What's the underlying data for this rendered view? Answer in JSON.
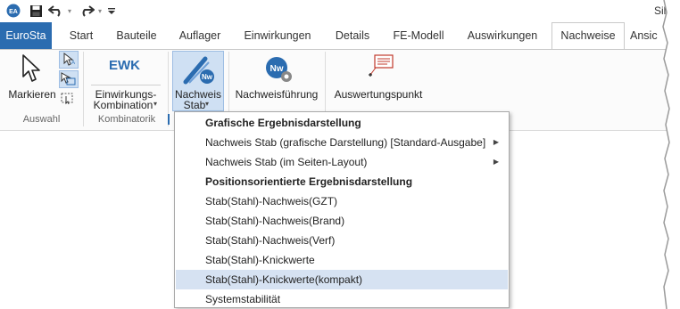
{
  "window": {
    "title_fragment": "Silo"
  },
  "quick_access": {
    "app_icon": "eurosta-logo-icon",
    "save_icon": "save-icon",
    "undo_icon": "undo-icon",
    "redo_icon": "redo-icon",
    "customize_icon": "customize-toolbar-icon"
  },
  "tabs": [
    {
      "label": "EuroSta",
      "state": "file"
    },
    {
      "label": "Start"
    },
    {
      "label": "Bauteile"
    },
    {
      "label": "Auflager"
    },
    {
      "label": "Einwirkungen"
    },
    {
      "label": "Details"
    },
    {
      "label": "FE-Modell"
    },
    {
      "label": "Auswirkungen"
    },
    {
      "label": "Nachweise",
      "state": "active"
    },
    {
      "label": "Ansic"
    }
  ],
  "ribbon": {
    "groups": [
      {
        "label": "Auswahl"
      },
      {
        "label": "Kombinatorik"
      }
    ],
    "buttons": {
      "markieren": "Markieren",
      "ewk_icon_text": "EWK",
      "einwirkungs_line1": "Einwirkungs-",
      "einwirkungs_line2": "Kombination",
      "nachweis_line1": "Nachweis",
      "nachweis_line2": "Stab",
      "nw_icon_text": "Nw",
      "nachweisfuehrung": "Nachweisführung",
      "auswertungspunkt": "Auswertungspunkt"
    }
  },
  "menu": {
    "items": [
      {
        "label": "Grafische Ergebnisdarstellung",
        "type": "header"
      },
      {
        "label": "Nachweis Stab (grafische Darstellung) [Standard-Ausgabe]",
        "submenu": true
      },
      {
        "label": "Nachweis Stab (im Seiten-Layout)",
        "submenu": true
      },
      {
        "label": "Positionsorientierte Ergebnisdarstellung",
        "type": "header"
      },
      {
        "label": "Stab(Stahl)-Nachweis(GZT)"
      },
      {
        "label": "Stab(Stahl)-Nachweis(Brand)"
      },
      {
        "label": "Stab(Stahl)-Nachweis(Verf)"
      },
      {
        "label": "Stab(Stahl)-Knickwerte"
      },
      {
        "label": "Stab(Stahl)-Knickwerte(kompakt)",
        "highlighted": true
      },
      {
        "label": "Systemstabilität"
      }
    ]
  },
  "colors": {
    "file_tab": "#2b6cb0",
    "accent_blue": "#2b6cb0",
    "highlight": "#d6e2f2",
    "selected_button": "#cfe0f3"
  }
}
